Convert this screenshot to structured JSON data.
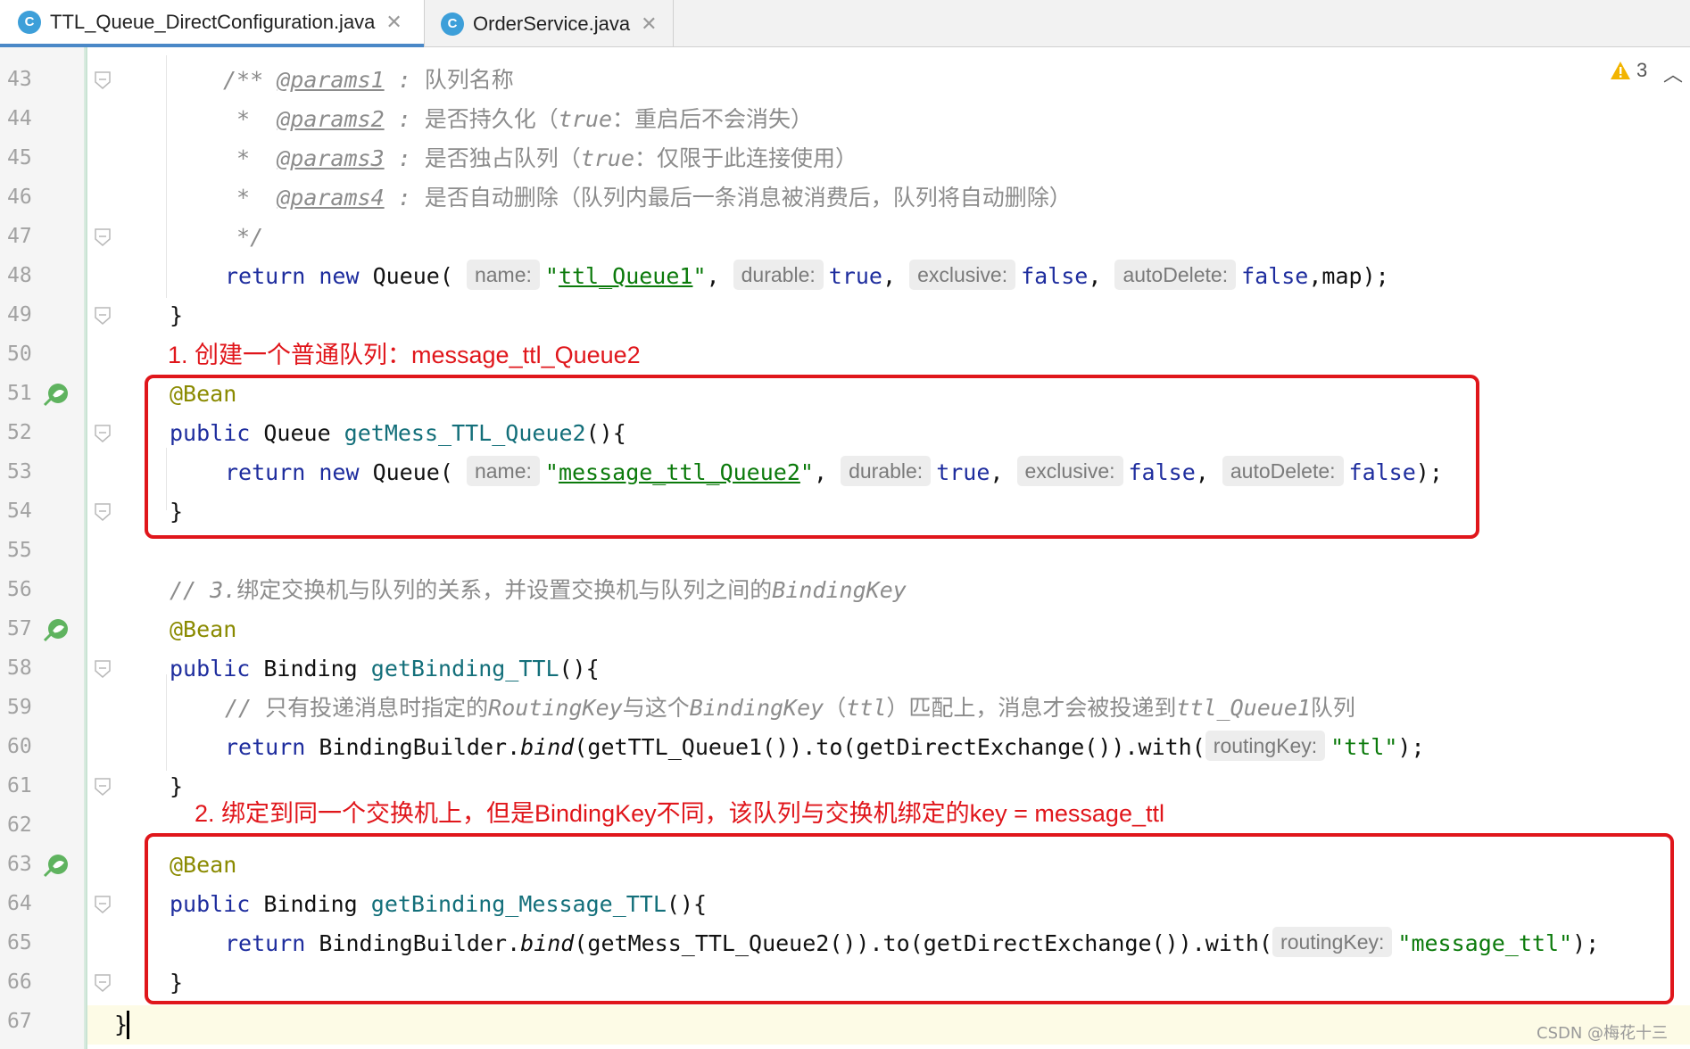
{
  "tabs": [
    {
      "icon_letter": "C",
      "label": "TTL_Queue_DirectConfiguration.java",
      "active": true
    },
    {
      "icon_letter": "C",
      "label": "OrderService.java",
      "active": false
    }
  ],
  "line_numbers": [
    "43",
    "44",
    "45",
    "46",
    "47",
    "48",
    "49",
    "50",
    "51",
    "52",
    "53",
    "54",
    "55",
    "56",
    "57",
    "58",
    "59",
    "60",
    "61",
    "62",
    "63",
    "64",
    "65",
    "66",
    "67"
  ],
  "inspections": {
    "warning_count": "3"
  },
  "code": {
    "l43": {
      "open": "/** ",
      "tag": "@params1",
      "colon": " : ",
      "text": "队列名称"
    },
    "l44": {
      "star": " *  ",
      "tag": "@params2",
      "colon": " : ",
      "text_a": "是否持久化（",
      "kw": "true",
      "text_b": "：重启后不会消失）"
    },
    "l45": {
      "star": " *  ",
      "tag": "@params3",
      "colon": " : ",
      "text_a": "是否独占队列（",
      "kw": "true",
      "text_b": "：仅限于此连接使用）"
    },
    "l46": {
      "star": " *  ",
      "tag": "@params4",
      "colon": " : ",
      "text": "是否自动删除（队列内最后一条消息被消费后，队列将自动删除）"
    },
    "l47": {
      "close": " */"
    },
    "l48": {
      "ret": "return",
      "new": " new ",
      "type": "Queue(",
      "h1": "name:",
      "s1": "ttl_Queue1",
      "h2": "durable:",
      "v2": "true",
      "h3": "exclusive:",
      "v3": "false",
      "h4": "autoDelete:",
      "v4": "false",
      "tail": ",map);"
    },
    "l49": {
      "text": "}"
    },
    "l51": {
      "ann": "@Bean"
    },
    "l52": {
      "pub": "public",
      "type": " Queue ",
      "fn": "getMess_TTL_Queue2",
      "tail": "(){"
    },
    "l53": {
      "ret": "return",
      "new": " new ",
      "type": "Queue(",
      "h1": "name:",
      "s1": "message_ttl_Queue2",
      "h2": "durable:",
      "v2": "true",
      "h3": "exclusive:",
      "v3": "false",
      "h4": "autoDelete:",
      "v4": "false",
      "tail": ");"
    },
    "l54": {
      "text": "}"
    },
    "l56": {
      "a": "// 3.",
      "b": "绑定交换机与队列的关系，并设置交换机与队列之间的",
      "c": "BindingKey"
    },
    "l57": {
      "ann": "@Bean"
    },
    "l58": {
      "pub": "public",
      "type": " Binding ",
      "fn": "getBinding_TTL",
      "tail": "(){"
    },
    "l59": {
      "a": "// ",
      "b": "只有投递消息时指定的",
      "c": "RoutingKey",
      "d": "与这个",
      "e": "BindingKey",
      "f": "（",
      "g": "ttl",
      "h": "）匹配上，消息才会被投递到",
      "i": "ttl_Queue1",
      "j": "队列"
    },
    "l60": {
      "ret": "return",
      "a": " BindingBuilder.",
      "bind": "bind",
      "b": "(getTTL_Queue1()).to(getDirectExchange()).with(",
      "hint": "routingKey:",
      "str": "\"ttl\"",
      "tail": ");"
    },
    "l61": {
      "text": "}"
    },
    "l63": {
      "ann": "@Bean"
    },
    "l64": {
      "pub": "public",
      "type": " Binding ",
      "fn": "getBinding_Message_TTL",
      "tail": "(){"
    },
    "l65": {
      "ret": "return",
      "a": " BindingBuilder.",
      "bind": "bind",
      "b": "(getMess_TTL_Queue2()).to(getDirectExchange()).with(",
      "hint": "routingKey:",
      "str": "\"message_ttl\"",
      "tail": ");"
    },
    "l66": {
      "text": "}"
    },
    "l67": {
      "text": "}"
    }
  },
  "annotations": {
    "note1": "1. 创建一个普通队列：message_ttl_Queue2",
    "note2": "2. 绑定到同一个交换机上，但是BindingKey不同，该队列与交换机绑定的key = message_ttl"
  },
  "watermark": "CSDN @梅花十三",
  "colors": {
    "red_annotation": "#e0161b",
    "keyword": "#1e2d9e",
    "string": "#0b7a0b",
    "annotation": "#8a8a00",
    "method": "#136f7a",
    "tab_accent": "#4a88c7"
  }
}
